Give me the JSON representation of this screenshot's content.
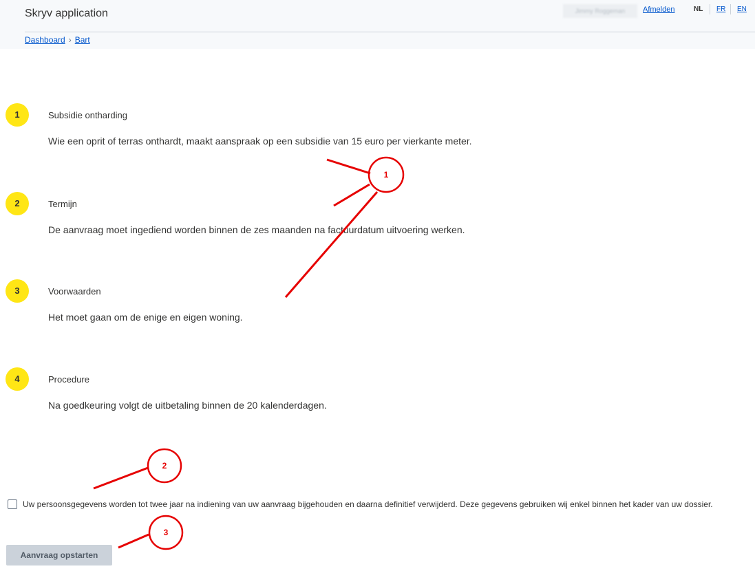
{
  "header": {
    "title": "Skryv application",
    "user_name": "Jimmy Roggeman",
    "logout_label": "Afmelden",
    "languages": [
      "NL",
      "FR",
      "EN"
    ],
    "active_language": "NL"
  },
  "breadcrumb": [
    "Dashboard",
    "Bart"
  ],
  "steps": [
    {
      "number": "1",
      "title": "Subsidie ontharding",
      "text": "Wie een oprit of terras onthardt, maakt aanspraak op een subsidie van 15 euro per vierkante meter."
    },
    {
      "number": "2",
      "title": "Termijn",
      "text": "De aanvraag moet ingediend worden binnen de zes maanden na factuurdatum uitvoering werken."
    },
    {
      "number": "3",
      "title": "Voorwaarden",
      "text": "Het moet gaan om de enige en eigen woning."
    },
    {
      "number": "4",
      "title": "Procedure",
      "text": "Na goedkeuring volgt de uitbetaling binnen de 20 kalenderdagen."
    }
  ],
  "consent": {
    "checked": false,
    "text": "Uw persoonsgegevens worden tot twee jaar na indiening van uw aanvraag bijgehouden en daarna definitief verwijderd. Deze gegevens gebruiken wij enkel binnen het kader van uw dossier."
  },
  "start_button_label": "Aanvraag opstarten",
  "annotations": [
    "1",
    "2",
    "3"
  ],
  "colors": {
    "badge": "#ffe615",
    "link": "#0055cc",
    "annotation": "#e60000",
    "header_bg": "#f7f9fb"
  }
}
